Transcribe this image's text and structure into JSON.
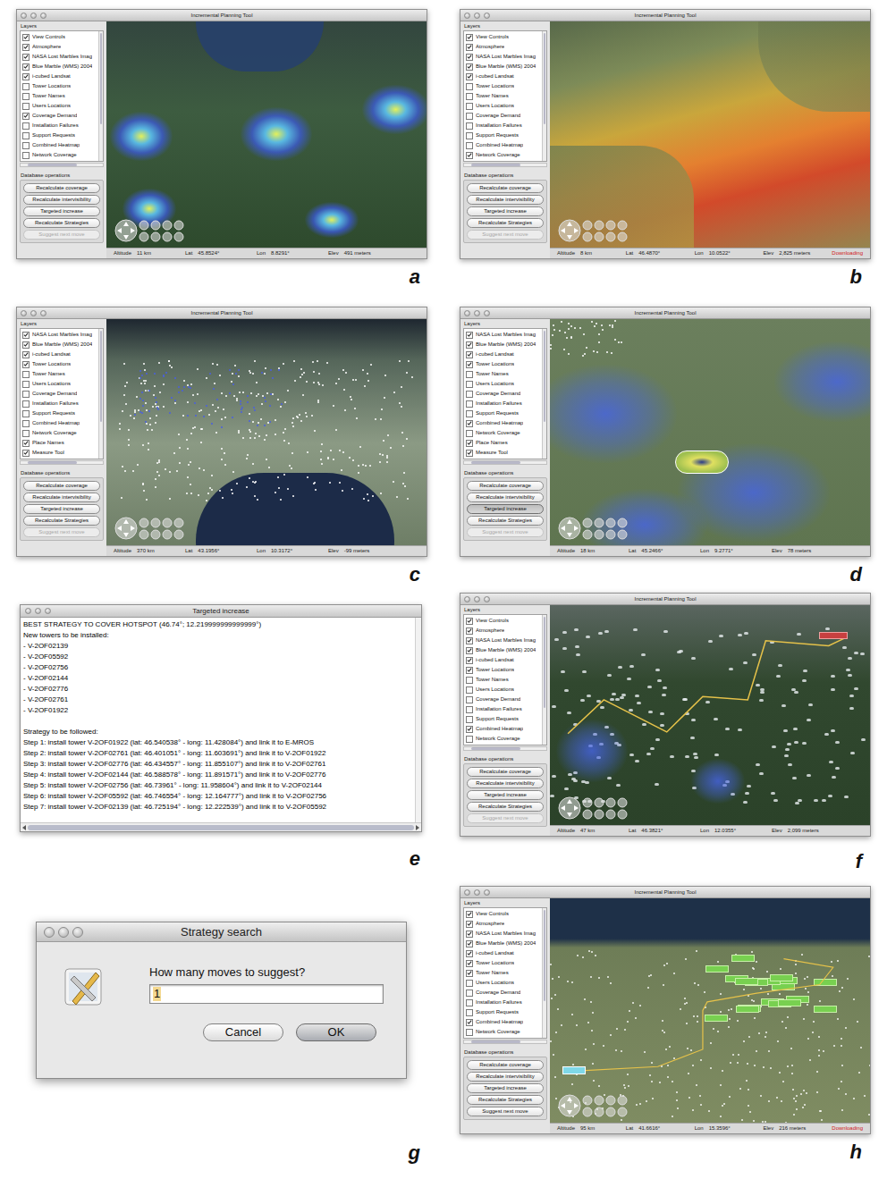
{
  "panels": [
    {
      "letter": "a",
      "kind": "map",
      "scene": "demand",
      "title": "Incremental Planning Tool",
      "layers_title": "Layers",
      "layers": [
        {
          "label": "View Controls",
          "checked": true
        },
        {
          "label": "Atmosphere",
          "checked": true
        },
        {
          "label": "NASA Lost Marbles Imag",
          "checked": true
        },
        {
          "label": "Blue Marble (WMS) 2004",
          "checked": true
        },
        {
          "label": "i-cubed Landsat",
          "checked": true
        },
        {
          "label": "Tower Locations",
          "checked": false
        },
        {
          "label": "Tower Names",
          "checked": false
        },
        {
          "label": "Users Locations",
          "checked": false
        },
        {
          "label": "Coverage Demand",
          "checked": true
        },
        {
          "label": "Installation Failures",
          "checked": false
        },
        {
          "label": "Support Requests",
          "checked": false
        },
        {
          "label": "Combined Heatmap",
          "checked": false
        },
        {
          "label": "Network Coverage",
          "checked": false
        }
      ],
      "operations_title": "Database operations",
      "operations": [
        {
          "label": "Recalculate coverage",
          "disabled": false,
          "selected": false
        },
        {
          "label": "Recalculate intervisibility",
          "disabled": false,
          "selected": false
        },
        {
          "label": "Targeted increase",
          "disabled": false,
          "selected": false
        },
        {
          "label": "Recalculate Strategies",
          "disabled": false,
          "selected": false
        },
        {
          "label": "Suggest next move",
          "disabled": true,
          "selected": false
        }
      ],
      "status": [
        {
          "label": "Altitude",
          "value": "11 km"
        },
        {
          "label": "Lat",
          "value": "45.8524°"
        },
        {
          "label": "Lon",
          "value": "8.8291°"
        },
        {
          "label": "Elev",
          "value": "491 meters"
        }
      ]
    },
    {
      "letter": "b",
      "kind": "map",
      "scene": "coverage",
      "title": "Incremental Planning Tool",
      "layers_title": "Layers",
      "layers": [
        {
          "label": "View Controls",
          "checked": true
        },
        {
          "label": "Atmosphere",
          "checked": true
        },
        {
          "label": "NASA Lost Marbles Imag",
          "checked": true
        },
        {
          "label": "Blue Marble (WMS) 2004",
          "checked": true
        },
        {
          "label": "i-cubed Landsat",
          "checked": true
        },
        {
          "label": "Tower Locations",
          "checked": false
        },
        {
          "label": "Tower Names",
          "checked": false
        },
        {
          "label": "Users Locations",
          "checked": false
        },
        {
          "label": "Coverage Demand",
          "checked": false
        },
        {
          "label": "Installation Failures",
          "checked": false
        },
        {
          "label": "Support Requests",
          "checked": false
        },
        {
          "label": "Combined Heatmap",
          "checked": false
        },
        {
          "label": "Network Coverage",
          "checked": true
        }
      ],
      "operations_title": "Database operations",
      "operations": [
        {
          "label": "Recalculate coverage",
          "disabled": false,
          "selected": false
        },
        {
          "label": "Recalculate intervisibility",
          "disabled": false,
          "selected": false
        },
        {
          "label": "Targeted increase",
          "disabled": false,
          "selected": false
        },
        {
          "label": "Recalculate Strategies",
          "disabled": false,
          "selected": false
        },
        {
          "label": "Suggest next move",
          "disabled": true,
          "selected": false
        }
      ],
      "status": [
        {
          "label": "Altitude",
          "value": "8 km"
        },
        {
          "label": "Lat",
          "value": "46.4870°"
        },
        {
          "label": "Lon",
          "value": "10.0522°"
        },
        {
          "label": "Elev",
          "value": "2,825 meters"
        }
      ],
      "notice": "Downloading"
    },
    {
      "letter": "c",
      "kind": "map",
      "scene": "towers",
      "title": "Incremental Planning Tool",
      "layers_title": "Layers",
      "layers": [
        {
          "label": "NASA Lost Marbles Imag",
          "checked": true
        },
        {
          "label": "Blue Marble (WMS) 2004",
          "checked": true
        },
        {
          "label": "i-cubed Landsat",
          "checked": true
        },
        {
          "label": "Tower Locations",
          "checked": true
        },
        {
          "label": "Tower Names",
          "checked": false
        },
        {
          "label": "Users Locations",
          "checked": false
        },
        {
          "label": "Coverage Demand",
          "checked": false
        },
        {
          "label": "Installation Failures",
          "checked": false
        },
        {
          "label": "Support Requests",
          "checked": false
        },
        {
          "label": "Combined Heatmap",
          "checked": false
        },
        {
          "label": "Network Coverage",
          "checked": false
        },
        {
          "label": "Place Names",
          "checked": true
        },
        {
          "label": "Measure Tool",
          "checked": true
        }
      ],
      "operations_title": "Database operations",
      "operations": [
        {
          "label": "Recalculate coverage",
          "disabled": false,
          "selected": false
        },
        {
          "label": "Recalculate intervisibility",
          "disabled": false,
          "selected": false
        },
        {
          "label": "Targeted increase",
          "disabled": false,
          "selected": false
        },
        {
          "label": "Recalculate Strategies",
          "disabled": false,
          "selected": false
        },
        {
          "label": "Suggest next move",
          "disabled": true,
          "selected": false
        }
      ],
      "status": [
        {
          "label": "Altitude",
          "value": "370 km"
        },
        {
          "label": "Lat",
          "value": "43.1956°"
        },
        {
          "label": "Lon",
          "value": "10.3172°"
        },
        {
          "label": "Elev",
          "value": "-99 meters"
        }
      ]
    },
    {
      "letter": "d",
      "kind": "map",
      "scene": "heatmap",
      "title": "Incremental Planning Tool",
      "layers_title": "Layers",
      "layers": [
        {
          "label": "NASA Lost Marbles Imag",
          "checked": true
        },
        {
          "label": "Blue Marble (WMS) 2004",
          "checked": true
        },
        {
          "label": "i-cubed Landsat",
          "checked": true
        },
        {
          "label": "Tower Locations",
          "checked": true
        },
        {
          "label": "Tower Names",
          "checked": false
        },
        {
          "label": "Users Locations",
          "checked": false
        },
        {
          "label": "Coverage Demand",
          "checked": false
        },
        {
          "label": "Installation Failures",
          "checked": false
        },
        {
          "label": "Support Requests",
          "checked": false
        },
        {
          "label": "Combined Heatmap",
          "checked": true
        },
        {
          "label": "Network Coverage",
          "checked": false
        },
        {
          "label": "Place Names",
          "checked": true
        },
        {
          "label": "Measure Tool",
          "checked": true
        }
      ],
      "operations_title": "Database operations",
      "operations": [
        {
          "label": "Recalculate coverage",
          "disabled": false,
          "selected": false
        },
        {
          "label": "Recalculate intervisibility",
          "disabled": false,
          "selected": false
        },
        {
          "label": "Targeted increase",
          "disabled": false,
          "selected": true
        },
        {
          "label": "Recalculate Strategies",
          "disabled": false,
          "selected": false
        },
        {
          "label": "Suggest next move",
          "disabled": true,
          "selected": false
        }
      ],
      "status": [
        {
          "label": "Altitude",
          "value": "18 km"
        },
        {
          "label": "Lat",
          "value": "45.2466°"
        },
        {
          "label": "Lon",
          "value": "9.2771°"
        },
        {
          "label": "Elev",
          "value": "78 meters"
        }
      ]
    },
    {
      "letter": "e",
      "kind": "text",
      "title": "Targeted increase",
      "heading": "BEST STRATEGY TO COVER HOTSPOT (46.74°; 12.219999999999999°)",
      "towers_title": "New towers to be installed:",
      "towers": [
        "- V-2OF02139",
        "- V-2OF05592",
        "- V-2OF02756",
        "- V-2OF02144",
        "- V-2OF02776",
        "- V-2OF02761",
        "- V-2OF01922"
      ],
      "steps_title": "Strategy to be followed:",
      "steps": [
        "Step 1: install tower V-2OF01922 (lat: 46.540538° - long: 11.428084°) and link it to E-MROS",
        "Step 2: install tower V-2OF02761 (lat: 46.401051° - long: 11.603691°) and link it to V-2OF01922",
        "Step 3: install tower V-2OF02776 (lat: 46.434557° - long: 11.855107°) and link it to V-2OF02761",
        "Step 4: install tower V-2OF02144 (lat: 46.588578° - long: 11.891571°) and link it to V-2OF02776",
        "Step 5: install tower V-2OF02756 (lat: 46.73961° - long: 11.958604°) and link it to V-2OF02144",
        "Step 6: install tower V-2OF05592 (lat: 46.746554° - long: 12.164777°) and link it to V-2OF02756",
        "Step 7: install tower V-2OF02139 (lat: 46.725194° - long: 12.222539°) and link it to V-2OF05592"
      ]
    },
    {
      "letter": "f",
      "kind": "map",
      "scene": "route",
      "title": "Incremental Planning Tool",
      "layers_title": "Layers",
      "layers": [
        {
          "label": "View Controls",
          "checked": true
        },
        {
          "label": "Atmosphere",
          "checked": true
        },
        {
          "label": "NASA Lost Marbles Imag",
          "checked": true
        },
        {
          "label": "Blue Marble (WMS) 2004",
          "checked": true
        },
        {
          "label": "i-cubed Landsat",
          "checked": true
        },
        {
          "label": "Tower Locations",
          "checked": true
        },
        {
          "label": "Tower Names",
          "checked": false
        },
        {
          "label": "Users Locations",
          "checked": false
        },
        {
          "label": "Coverage Demand",
          "checked": false
        },
        {
          "label": "Installation Failures",
          "checked": false
        },
        {
          "label": "Support Requests",
          "checked": false
        },
        {
          "label": "Combined Heatmap",
          "checked": true
        },
        {
          "label": "Network Coverage",
          "checked": false
        }
      ],
      "operations_title": "Database operations",
      "operations": [
        {
          "label": "Recalculate coverage",
          "disabled": false,
          "selected": false
        },
        {
          "label": "Recalculate intervisibility",
          "disabled": false,
          "selected": false
        },
        {
          "label": "Targeted increase",
          "disabled": false,
          "selected": false
        },
        {
          "label": "Recalculate Strategies",
          "disabled": false,
          "selected": false
        },
        {
          "label": "Suggest next move",
          "disabled": true,
          "selected": false
        }
      ],
      "status": [
        {
          "label": "Altitude",
          "value": "47 km"
        },
        {
          "label": "Lat",
          "value": "46.3821°"
        },
        {
          "label": "Lon",
          "value": "12.0355°"
        },
        {
          "label": "Elev",
          "value": "2,099 meters"
        }
      ]
    },
    {
      "letter": "g",
      "kind": "dialog",
      "title": "Strategy search",
      "prompt": "How many moves to suggest?",
      "value": "1",
      "buttons": [
        {
          "label": "Cancel",
          "default": false
        },
        {
          "label": "OK",
          "default": true
        }
      ]
    },
    {
      "letter": "h",
      "kind": "map",
      "scene": "network",
      "title": "Incremental Planning Tool",
      "layers_title": "Layers",
      "layers": [
        {
          "label": "View Controls",
          "checked": true
        },
        {
          "label": "Atmosphere",
          "checked": true
        },
        {
          "label": "NASA Lost Marbles Imag",
          "checked": true
        },
        {
          "label": "Blue Marble (WMS) 2004",
          "checked": true
        },
        {
          "label": "i-cubed Landsat",
          "checked": true
        },
        {
          "label": "Tower Locations",
          "checked": true
        },
        {
          "label": "Tower Names",
          "checked": true
        },
        {
          "label": "Users Locations",
          "checked": false
        },
        {
          "label": "Coverage Demand",
          "checked": false
        },
        {
          "label": "Installation Failures",
          "checked": false
        },
        {
          "label": "Support Requests",
          "checked": false
        },
        {
          "label": "Combined Heatmap",
          "checked": true
        },
        {
          "label": "Network Coverage",
          "checked": false
        }
      ],
      "operations_title": "Database operations",
      "operations": [
        {
          "label": "Recalculate coverage",
          "disabled": false,
          "selected": false
        },
        {
          "label": "Recalculate intervisibility",
          "disabled": false,
          "selected": false
        },
        {
          "label": "Targeted increase",
          "disabled": false,
          "selected": false
        },
        {
          "label": "Recalculate Strategies",
          "disabled": false,
          "selected": false
        },
        {
          "label": "Suggest next move",
          "disabled": false,
          "selected": false
        }
      ],
      "status": [
        {
          "label": "Altitude",
          "value": "95 km"
        },
        {
          "label": "Lat",
          "value": "41.6616°"
        },
        {
          "label": "Lon",
          "value": "15.3596°"
        },
        {
          "label": "Elev",
          "value": "216 meters"
        }
      ],
      "notice": "Downloading"
    }
  ]
}
